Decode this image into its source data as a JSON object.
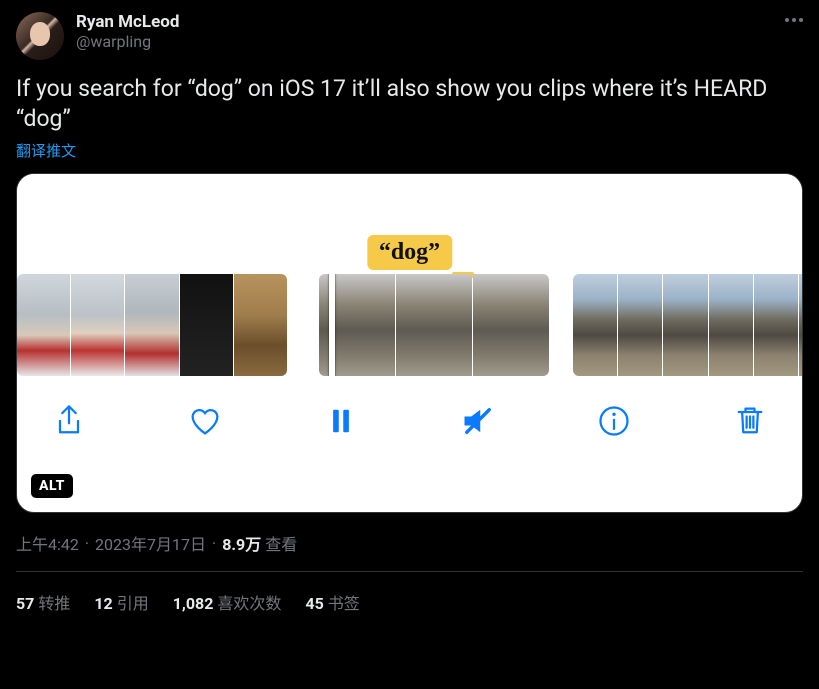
{
  "author": {
    "display_name": "Ryan McLeod",
    "handle": "@warpling"
  },
  "tweet_text": "If you search for “dog” on iOS 17 it’ll also show you clips where it’s HEARD “dog”",
  "translate_label": "翻译推文",
  "media": {
    "tooltip_text": "“dog”",
    "alt_badge": "ALT"
  },
  "meta": {
    "time": "上午4:42",
    "date": "2023年7月17日",
    "views_count": "8.9万",
    "views_label": "查看"
  },
  "stats": {
    "retweets": {
      "count": "57",
      "label": "转推"
    },
    "quotes": {
      "count": "12",
      "label": "引用"
    },
    "likes": {
      "count": "1,082",
      "label": "喜欢次数"
    },
    "bookmarks": {
      "count": "45",
      "label": "书签"
    }
  }
}
